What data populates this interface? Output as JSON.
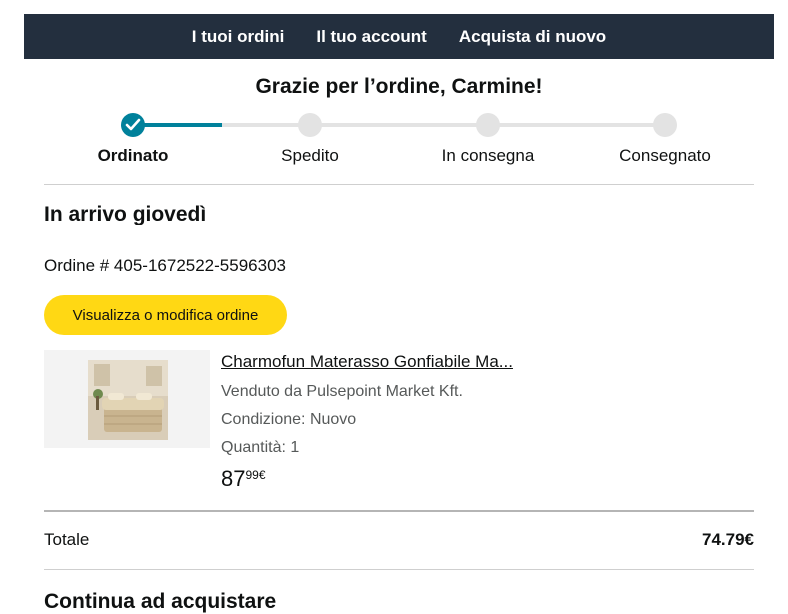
{
  "nav": {
    "orders": "I tuoi ordini",
    "account": "Il tuo account",
    "buy_again": "Acquista di nuovo"
  },
  "greeting": "Grazie per l’ordine, Carmine!",
  "tracker": {
    "steps": [
      "Ordinato",
      "Spedito",
      "In consegna",
      "Consegnato"
    ],
    "current_step": 1,
    "accent_color": "#00819b"
  },
  "arrival": "In arrivo giovedì",
  "order_number": "Ordine # 405-1672522-5596303",
  "view_button": "Visualizza o modifica ordine",
  "product": {
    "title": "Charmofun Materasso Gonfiabile Ma...",
    "seller": "Venduto da Pulsepoint Market Kft.",
    "condition": "Condizione: Nuovo",
    "quantity": "Quantità: 1",
    "price_whole": "87",
    "price_fraction": "99€"
  },
  "total": {
    "label": "Totale",
    "value": "74.79€"
  },
  "continue_heading": "Continua ad acquistare",
  "colors": {
    "nav_bg": "#232f3e",
    "button_bg": "#ffd814"
  }
}
